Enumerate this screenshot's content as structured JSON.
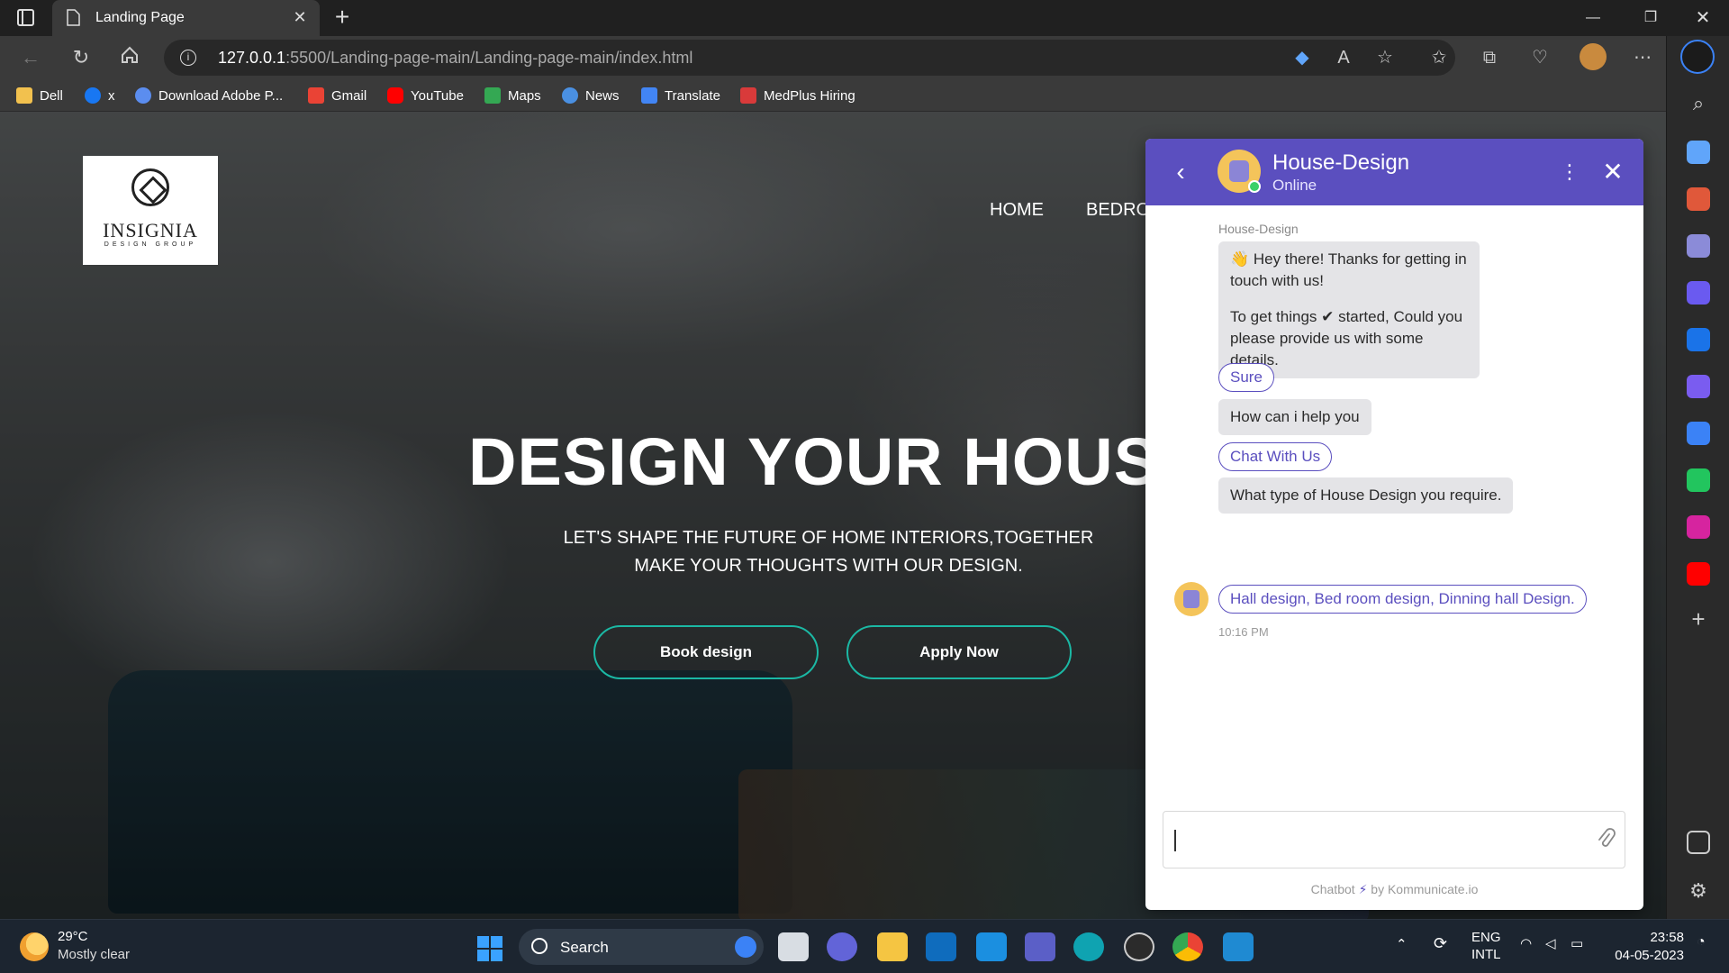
{
  "browser": {
    "tab_title": "Landing Page",
    "url_host": "127.0.0.1",
    "url_path": ":5500/Landing-page-main/Landing-page-main/index.html",
    "bookmarks": [
      "Dell",
      "x",
      "Download Adobe P...",
      "Gmail",
      "YouTube",
      "Maps",
      "News",
      "Translate",
      "MedPlus Hiring"
    ]
  },
  "site": {
    "logo_name": "INSIGNIA",
    "logo_sub": "DESIGN GROUP",
    "nav": [
      "HOME",
      "BEDRO"
    ],
    "hero_title": "DESIGN YOUR HOUS",
    "hero_sub_line1": "LET'S SHAPE THE FUTURE OF HOME INTERIORS,TOGETHER",
    "hero_sub_line2": "MAKE YOUR THOUGHTS WITH OUR DESIGN.",
    "btn_book": "Book design",
    "btn_apply": "Apply Now",
    "accent": "#1bb8a4"
  },
  "chat": {
    "bot_name": "House-Design",
    "status": "Online",
    "sender_label": "House-Design",
    "msg1_line1": "👋 Hey there! Thanks for getting in touch with us!",
    "msg1_line2": "To get things ✔ started, Could you please provide us with some details.",
    "quick_sure": "Sure",
    "msg2": "How can i help you",
    "quick_chat": "Chat With Us",
    "msg3": "What type of House Design you require.",
    "quick_design": "Hall design, Bed room design, Dinning hall Design.",
    "time": "10:16 PM",
    "input_value": "",
    "powered_prefix": "Chatbot",
    "powered_suffix": "by Kommunicate.io",
    "header_color": "#5b4fbf"
  },
  "taskbar": {
    "temp": "29°C",
    "weather": "Mostly clear",
    "search_label": "Search",
    "lang_line1": "ENG",
    "lang_line2": "INTL",
    "time": "23:58",
    "date": "04-05-2023"
  }
}
